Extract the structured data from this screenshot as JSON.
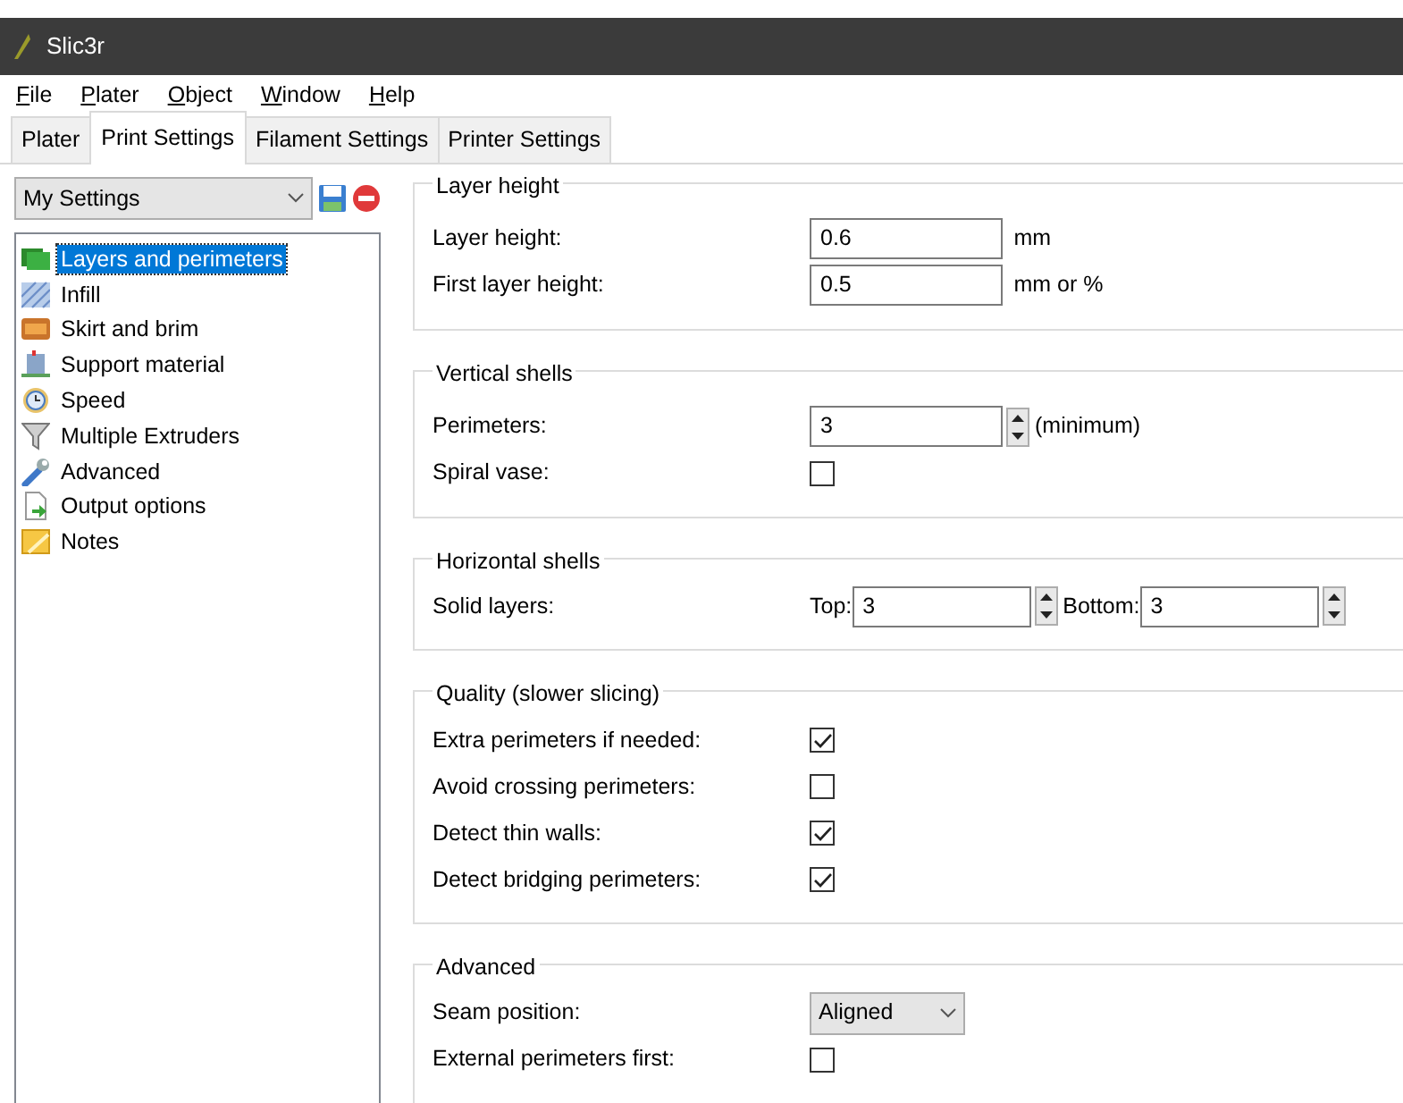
{
  "window": {
    "title": "Slic3r"
  },
  "menu": [
    "File",
    "Plater",
    "Object",
    "Window",
    "Help"
  ],
  "tabs": [
    {
      "label": "Plater",
      "selected": false
    },
    {
      "label": "Print Settings",
      "selected": true
    },
    {
      "label": "Filament Settings",
      "selected": false
    },
    {
      "label": "Printer Settings",
      "selected": false
    }
  ],
  "preset": {
    "value": "My Settings"
  },
  "sidebar": {
    "items": [
      {
        "label": "Layers and perimeters",
        "selected": true
      },
      {
        "label": "Infill",
        "selected": false
      },
      {
        "label": "Skirt and brim",
        "selected": false
      },
      {
        "label": "Support material",
        "selected": false
      },
      {
        "label": "Speed",
        "selected": false
      },
      {
        "label": "Multiple Extruders",
        "selected": false
      },
      {
        "label": "Advanced",
        "selected": false
      },
      {
        "label": "Output options",
        "selected": false
      },
      {
        "label": "Notes",
        "selected": false
      }
    ]
  },
  "groups": [
    {
      "title": "Layer height",
      "rows": [
        {
          "kind": "text",
          "label": "Layer height:",
          "value": "0.6",
          "unit": "mm"
        },
        {
          "kind": "text",
          "label": "First layer height:",
          "value": "0.5",
          "unit": "mm or %"
        }
      ]
    },
    {
      "title": "Vertical shells",
      "rows": [
        {
          "kind": "spin",
          "label": "Perimeters:",
          "value": "3",
          "unit": "(minimum)"
        },
        {
          "kind": "check",
          "label": "Spiral vase:",
          "checked": false
        }
      ]
    },
    {
      "title": "Horizontal shells",
      "rows": [
        {
          "kind": "dual",
          "label": "Solid layers:",
          "parts": [
            {
              "label": "Top:",
              "value": "3"
            },
            {
              "label": "Bottom:",
              "value": "3"
            }
          ]
        }
      ]
    },
    {
      "title": "Quality (slower slicing)",
      "rows": [
        {
          "kind": "check",
          "label": "Extra perimeters if needed:",
          "checked": true
        },
        {
          "kind": "check",
          "label": "Avoid crossing perimeters:",
          "checked": false
        },
        {
          "kind": "check",
          "label": "Detect thin walls:",
          "checked": true
        },
        {
          "kind": "check",
          "label": "Detect bridging perimeters:",
          "checked": true
        }
      ]
    },
    {
      "title": "Advanced",
      "rows": [
        {
          "kind": "select",
          "label": "Seam position:",
          "value": "Aligned"
        },
        {
          "kind": "check",
          "label": "External perimeters first:",
          "checked": false
        }
      ]
    }
  ]
}
